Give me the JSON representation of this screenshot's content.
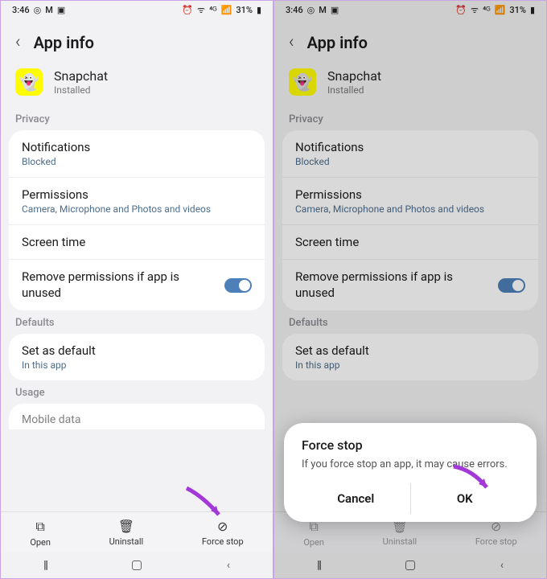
{
  "statusbar": {
    "time": "3:46",
    "battery": "31%"
  },
  "header": {
    "title": "App info"
  },
  "app": {
    "name": "Snapchat",
    "status": "Installed",
    "emoji": "👻"
  },
  "sections": {
    "privacy": "Privacy",
    "defaults": "Defaults",
    "usage": "Usage"
  },
  "privacy_rows": {
    "notifications": {
      "title": "Notifications",
      "sub": "Blocked"
    },
    "permissions": {
      "title": "Permissions",
      "sub": "Camera, Microphone and Photos and videos"
    },
    "screentime": {
      "title": "Screen time"
    },
    "remove": {
      "title": "Remove permissions if app is unused"
    }
  },
  "defaults_rows": {
    "setdefault": {
      "title": "Set as default",
      "sub": "In this app"
    }
  },
  "usage_rows": {
    "mobiledata": "Mobile data"
  },
  "bottombar": {
    "open": "Open",
    "uninstall": "Uninstall",
    "forcestop": "Force stop"
  },
  "dialog": {
    "title": "Force stop",
    "message": "If you force stop an app, it may cause errors.",
    "cancel": "Cancel",
    "ok": "OK"
  }
}
